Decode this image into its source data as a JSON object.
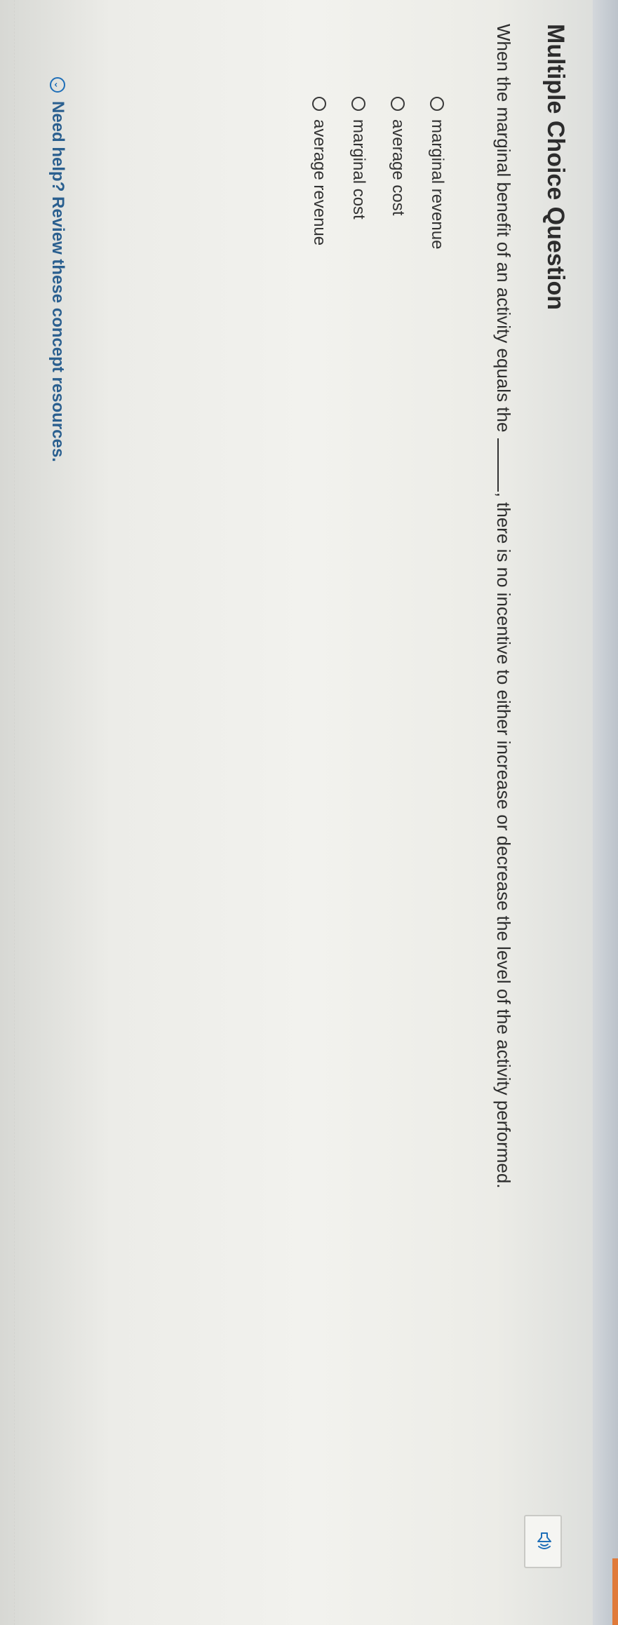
{
  "header": {
    "title": "Multiple Choice Question"
  },
  "question": {
    "text_before": "When the marginal benefit of an activity equals the",
    "text_after": ", there is no incentive to either increase or decrease the level of the activity performed."
  },
  "choices": [
    {
      "label": "marginal revenue"
    },
    {
      "label": "average cost"
    },
    {
      "label": "marginal cost"
    },
    {
      "label": "average revenue"
    }
  ],
  "help": {
    "icon": "chevron-down-icon",
    "text": "Need help? Review these concept resources."
  },
  "toolbar": {
    "speaker_icon": "speaker-icon"
  },
  "colors": {
    "accent": "#e07a3a",
    "link": "#2a5f8f"
  }
}
